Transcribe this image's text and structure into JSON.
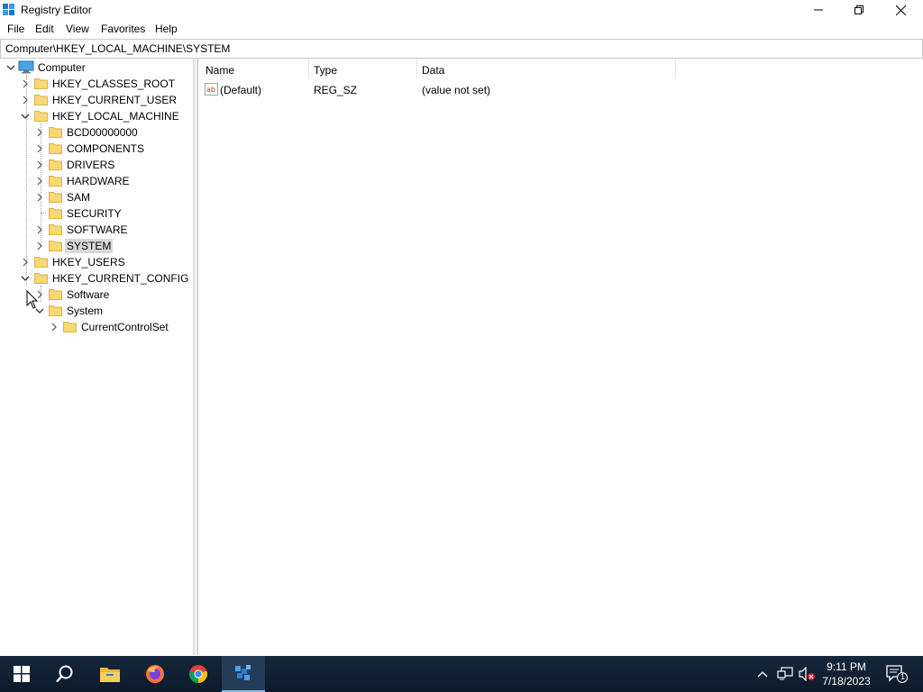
{
  "window": {
    "title": "Registry Editor"
  },
  "menu": [
    "File",
    "Edit",
    "View",
    "Favorites",
    "Help"
  ],
  "address": "Computer\\HKEY_LOCAL_MACHINE\\SYSTEM",
  "tree": {
    "root": "Computer",
    "hives": {
      "classes_root": "HKEY_CLASSES_ROOT",
      "current_user": "HKEY_CURRENT_USER",
      "local_machine": "HKEY_LOCAL_MACHINE",
      "users": "HKEY_USERS",
      "current_config": "HKEY_CURRENT_CONFIG"
    },
    "local_machine_children": [
      "BCD00000000",
      "COMPONENTS",
      "DRIVERS",
      "HARDWARE",
      "SAM",
      "SECURITY",
      "SOFTWARE",
      "SYSTEM"
    ],
    "current_config_children": {
      "software": "Software",
      "system": "System",
      "current_control_set": "CurrentControlSet"
    },
    "selected": "SYSTEM"
  },
  "list": {
    "columns": [
      "Name",
      "Type",
      "Data"
    ],
    "rows": [
      {
        "name": "(Default)",
        "type": "REG_SZ",
        "data": "(value not set)"
      }
    ]
  },
  "taskbar": {
    "time": "9:11 PM",
    "date": "7/18/2023",
    "notification_count": "1"
  },
  "colors": {
    "selection": "#d9d9d9",
    "folder": "#f8d775",
    "taskbar": "#0c1a2a"
  }
}
